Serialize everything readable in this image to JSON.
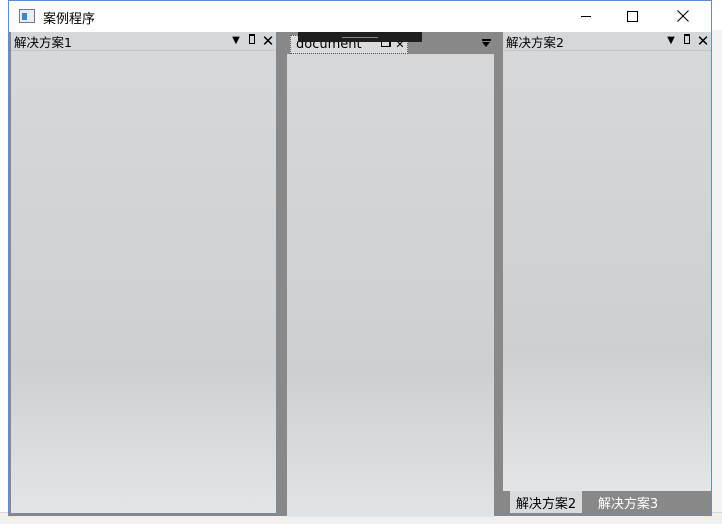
{
  "window": {
    "title": "案例程序"
  },
  "left_pane": {
    "title": "解决方案1"
  },
  "document_pane": {
    "tab_label": "document"
  },
  "right_pane": {
    "title": "解决方案2",
    "bottom_tabs": [
      {
        "label": "解决方案2",
        "active": true
      },
      {
        "label": "解决方案3",
        "active": false
      }
    ]
  },
  "icons": {
    "dropdown": "chevron-down-icon",
    "pin": "pin-icon",
    "close": "close-icon"
  },
  "colors": {
    "pane_bg": "#d3d6d8",
    "dock_gap": "#888888",
    "border_accent": "#5a8fd1"
  }
}
